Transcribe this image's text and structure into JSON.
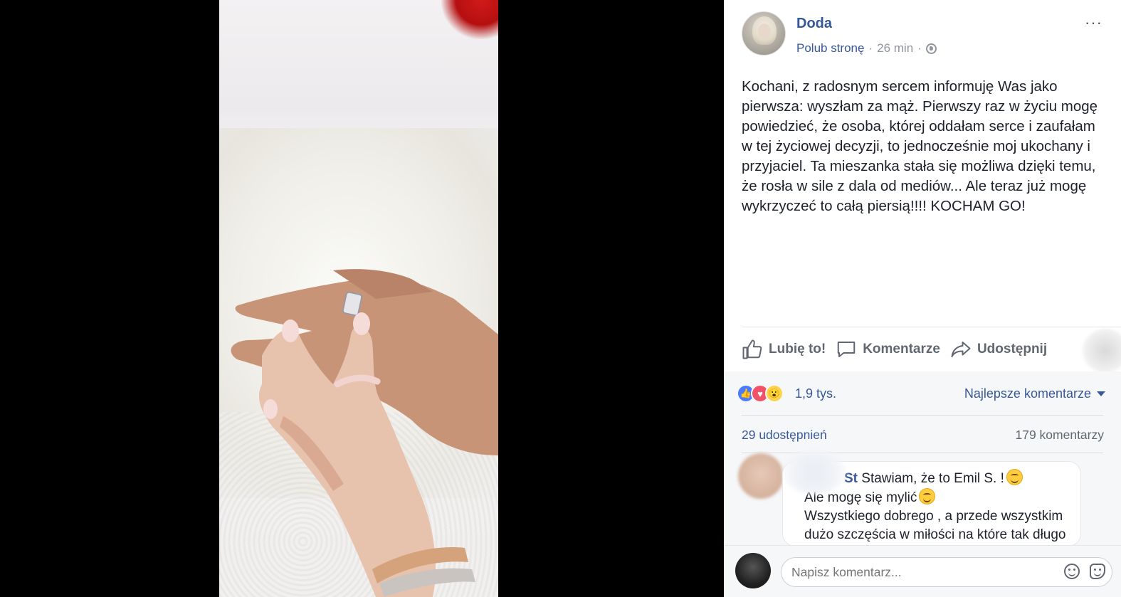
{
  "post": {
    "page_name": "Doda",
    "like_page": "Polub stronę",
    "separator": "·",
    "time": "26 min",
    "more": "···",
    "text": "Kochani, z radosnym sercem informuję Was jako pierwsza: wyszłam za mąż. Pierwszy raz w życiu mogę powiedzieć, że osoba, której oddałam serce i zaufałam w tej życiowej decyzji, to jednocześnie moj ukochany i przyjaciel. Ta mieszanka stała się możliwa dzięki temu, że rosła w sile z dala od mediów... Ale teraz już mogę wykrzyczeć to całą piersią!!!! KOCHAM GO!"
  },
  "actions": {
    "like": "Lubię to!",
    "comment": "Komentarze",
    "share": "Udostępnij"
  },
  "stats": {
    "reactions": "1,9 tys.",
    "reaction_icons": [
      "like-icon",
      "love-icon",
      "wow-icon"
    ],
    "best_comments": "Najlepsze komentarze",
    "shares": "29 udostępnień",
    "comments": "179 komentarzy"
  },
  "comment": {
    "author": "St",
    "line1": "Stawiam, że to Emil S. !",
    "line2": "Ale mogę się mylić",
    "line3": "Wszystkiego dobrego , a przede wszystkim",
    "line4": "dużo szczęścia w miłości na które tak długo"
  },
  "compose": {
    "placeholder": "Napisz komentarz..."
  },
  "colors": {
    "link": "#365899",
    "text": "#1d2129",
    "muted": "#90949c",
    "panel_bg": "#f6f7f9"
  }
}
